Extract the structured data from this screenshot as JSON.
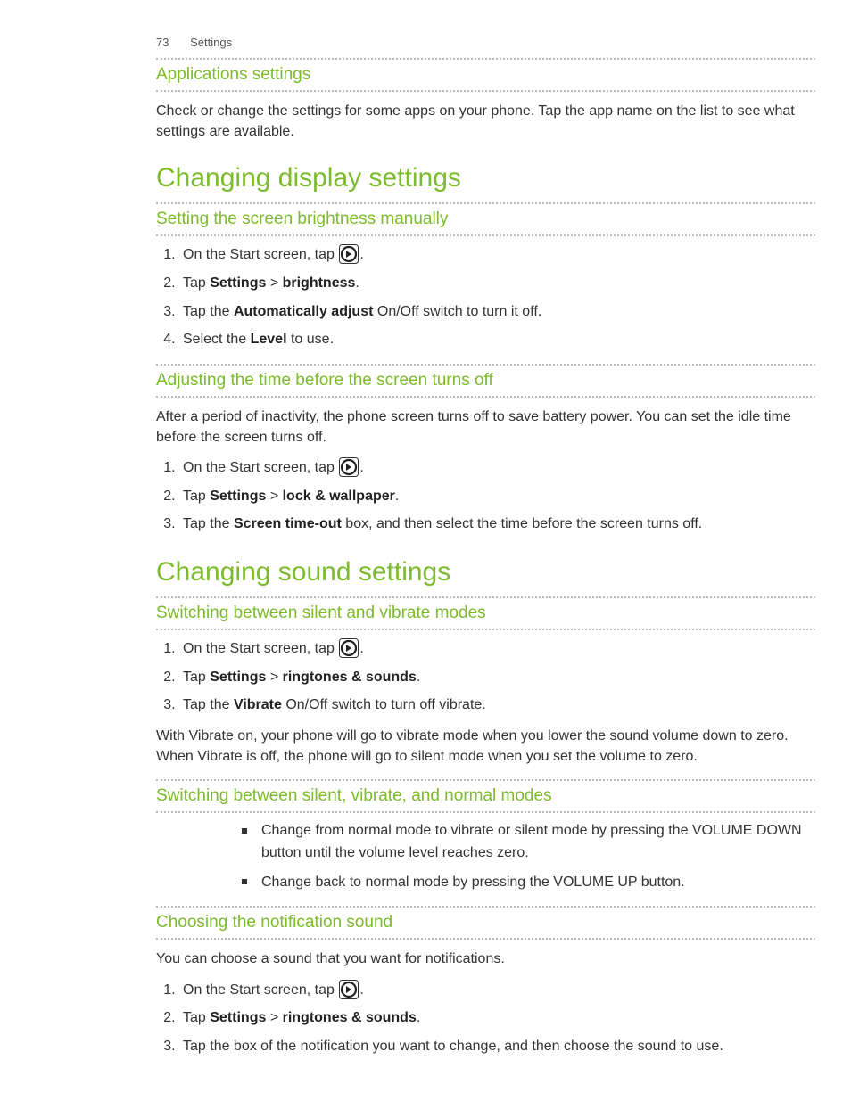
{
  "header": {
    "page_number": "73",
    "section": "Settings"
  },
  "s1": {
    "title": "Applications settings",
    "body": "Check or change the settings for some apps on your phone. Tap the app name on the list to see what settings are available."
  },
  "h1a": "Changing display settings",
  "s2": {
    "title": "Setting the screen brightness manually",
    "step1_a": "On the Start screen, tap ",
    "step1_b": ".",
    "step2_a": "Tap ",
    "step2_b": "Settings",
    "step2_c": " > ",
    "step2_d": "brightness",
    "step2_e": ".",
    "step3_a": "Tap the ",
    "step3_b": "Automatically adjust",
    "step3_c": " On/Off switch to turn it off.",
    "step4_a": "Select the ",
    "step4_b": "Level",
    "step4_c": " to use."
  },
  "s3": {
    "title": "Adjusting the time before the screen turns off",
    "intro": "After a period of inactivity, the phone screen turns off to save battery power. You can set the idle time before the screen turns off.",
    "step1_a": "On the Start screen, tap ",
    "step1_b": ".",
    "step2_a": "Tap ",
    "step2_b": "Settings",
    "step2_c": " > ",
    "step2_d": "lock & wallpaper",
    "step2_e": ".",
    "step3_a": "Tap the ",
    "step3_b": "Screen time-out",
    "step3_c": " box, and then select the time before the screen turns off."
  },
  "h1b": "Changing sound settings",
  "s4": {
    "title": "Switching between silent and vibrate modes",
    "step1_a": "On the Start screen, tap ",
    "step1_b": ".",
    "step2_a": "Tap ",
    "step2_b": "Settings",
    "step2_c": " > ",
    "step2_d": "ringtones & sounds",
    "step2_e": ".",
    "step3_a": "Tap the ",
    "step3_b": "Vibrate",
    "step3_c": " On/Off switch to turn off vibrate.",
    "outro": "With Vibrate on, your phone will go to vibrate mode when you lower the sound volume down to zero. When Vibrate is off, the phone will go to silent mode when you set the volume to zero."
  },
  "s5": {
    "title": "Switching between silent, vibrate, and normal modes",
    "b1": "Change from normal mode to vibrate or silent mode by pressing the VOLUME DOWN button until the volume level reaches zero.",
    "b2": "Change back to normal mode by pressing the VOLUME UP button."
  },
  "s6": {
    "title": "Choosing the notification sound",
    "intro": "You can choose a sound that you want for notifications.",
    "step1_a": "On the Start screen, tap ",
    "step1_b": ".",
    "step2_a": "Tap ",
    "step2_b": "Settings",
    "step2_c": " > ",
    "step2_d": "ringtones & sounds",
    "step2_e": ".",
    "step3": "Tap the box of the notification you want to change, and then choose the sound to use."
  },
  "icon_name": "arrow-right-circle-icon"
}
